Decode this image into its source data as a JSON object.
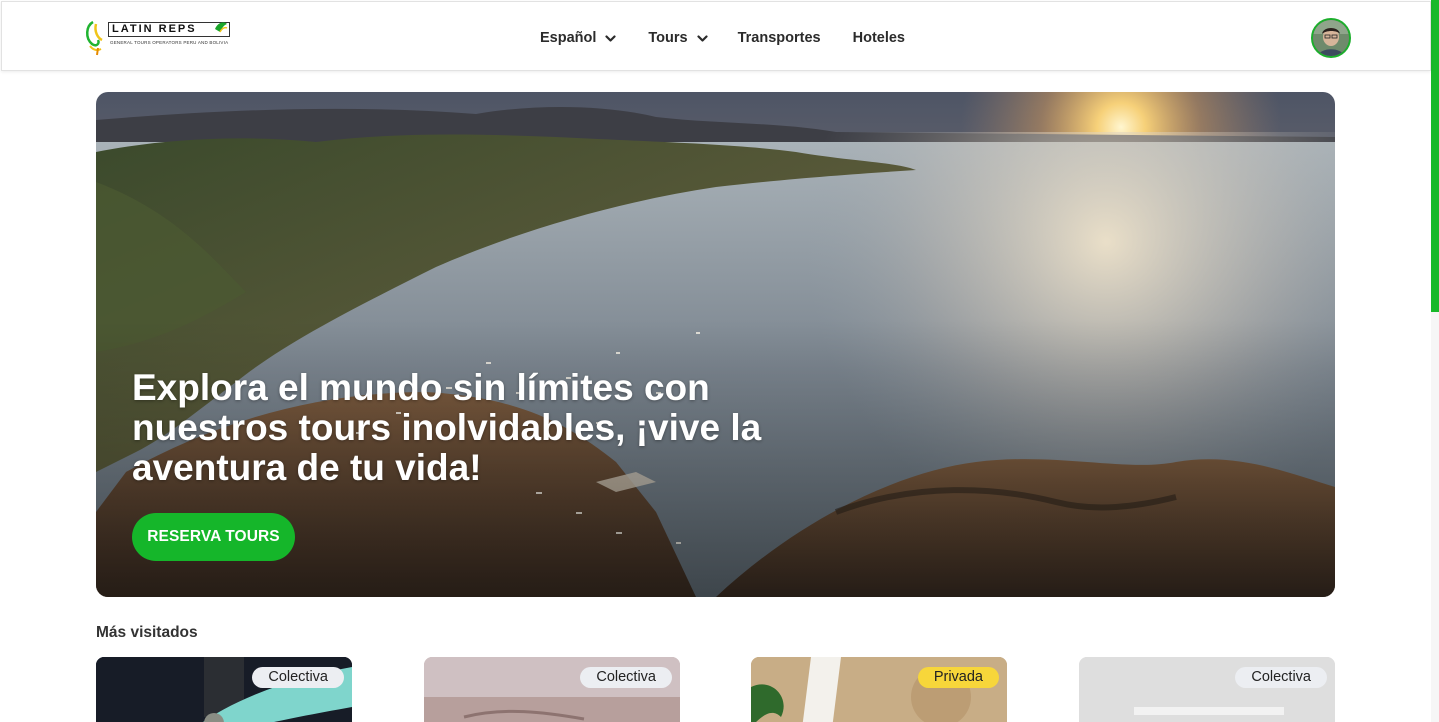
{
  "brand": {
    "name": "LATIN REPS",
    "tagline": "GENERAL TOURS OPERATORS PERU AND BOLIVIA"
  },
  "nav": {
    "language": "Español",
    "tours": "Tours",
    "transportes": "Transportes",
    "hoteles": "Hoteles"
  },
  "hero": {
    "title": "Explora el mundo sin límites con nuestros tours inolvidables, ¡vive la aventura de tu vida!",
    "cta": "RESERVA TOURS"
  },
  "section": {
    "title": "Más visitados"
  },
  "cards": [
    {
      "badge": "Colectiva"
    },
    {
      "badge": "Colectiva"
    },
    {
      "badge": "Privada"
    },
    {
      "badge": "Colectiva"
    }
  ],
  "colors": {
    "accent": "#15b62a",
    "badge_private": "#f7d63a",
    "badge_default": "#eceef2"
  },
  "icons": {
    "dropdown": "chevron-down-icon",
    "user": "avatar"
  }
}
